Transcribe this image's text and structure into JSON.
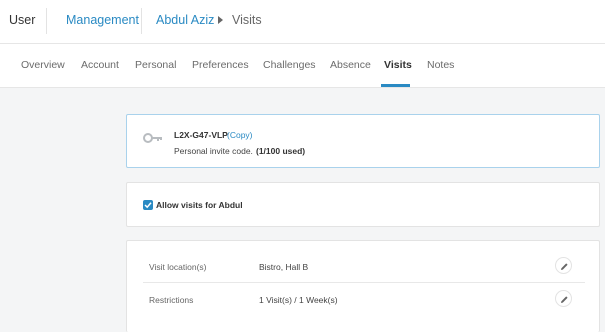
{
  "header": {
    "user_label": "User",
    "management_label": "Management",
    "person_label": "Abdul Aziz",
    "current_label": "Visits"
  },
  "tabs": [
    {
      "label": "Overview"
    },
    {
      "label": "Account"
    },
    {
      "label": "Personal"
    },
    {
      "label": "Preferences"
    },
    {
      "label": "Challenges"
    },
    {
      "label": "Absence"
    },
    {
      "label": "Visits",
      "active": true
    },
    {
      "label": "Notes"
    }
  ],
  "invite": {
    "code": "L2X-G47-VLP",
    "copy_label": "(Copy)",
    "description": "Personal invite code.",
    "usage": "(1/100 used)"
  },
  "allow": {
    "label": "Allow visits for Abdul",
    "checked": true
  },
  "settings": {
    "rows": [
      {
        "key": "Visit location(s)",
        "value": "Bistro, Hall B"
      },
      {
        "key": "Restrictions",
        "value": "1 Visit(s) / 1 Week(s)"
      }
    ]
  },
  "colors": {
    "accent": "#2a8ac3",
    "background": "#f4f5f6",
    "card_highlight_border": "#a9d2ec"
  },
  "icons": {
    "breadcrumb_separator": "caret-right-icon",
    "invite": "key-icon",
    "checkbox": "check-icon",
    "edit": "pencil-icon"
  }
}
